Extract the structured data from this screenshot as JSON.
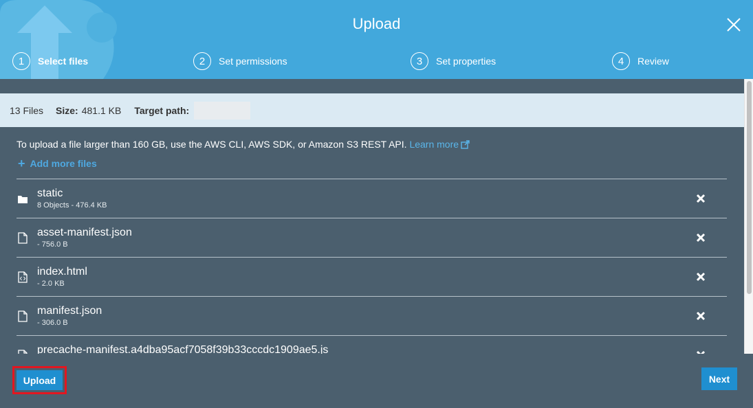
{
  "dialog": {
    "title": "Upload"
  },
  "steps": [
    {
      "num": "1",
      "label": "Select files",
      "active": true
    },
    {
      "num": "2",
      "label": "Set permissions",
      "active": false
    },
    {
      "num": "3",
      "label": "Set properties",
      "active": false
    },
    {
      "num": "4",
      "label": "Review",
      "active": false
    }
  ],
  "summary": {
    "files": "13 Files",
    "size_label": "Size:",
    "size_value": "481.1 KB",
    "target_label": "Target path:",
    "target_value": ""
  },
  "info": {
    "text": "To upload a file larger than 160 GB, use the AWS CLI, AWS SDK, or Amazon S3 REST API.",
    "link": "Learn more"
  },
  "add_more": {
    "plus": "+",
    "label": "Add more files"
  },
  "files": [
    {
      "icon": "folder-icon",
      "name": "static",
      "meta": "8 Objects - 476.4 KB"
    },
    {
      "icon": "file-icon",
      "name": "asset-manifest.json",
      "meta": "- 756.0 B"
    },
    {
      "icon": "code-file-icon",
      "name": "index.html",
      "meta": "- 2.0 KB"
    },
    {
      "icon": "file-icon",
      "name": "manifest.json",
      "meta": "- 306.0 B"
    },
    {
      "icon": "file-icon",
      "name": "precache-manifest.a4dba95acf7058f39b33cccdc1909ae5.js",
      "meta": ""
    }
  ],
  "footer": {
    "upload_label": "Upload",
    "next_label": "Next"
  },
  "colors": {
    "header": "#42a8dc",
    "body": "#4b5f6e",
    "summary_bg": "#dbeaf3",
    "button": "#1f8fd0",
    "highlight": "#e3161f"
  }
}
